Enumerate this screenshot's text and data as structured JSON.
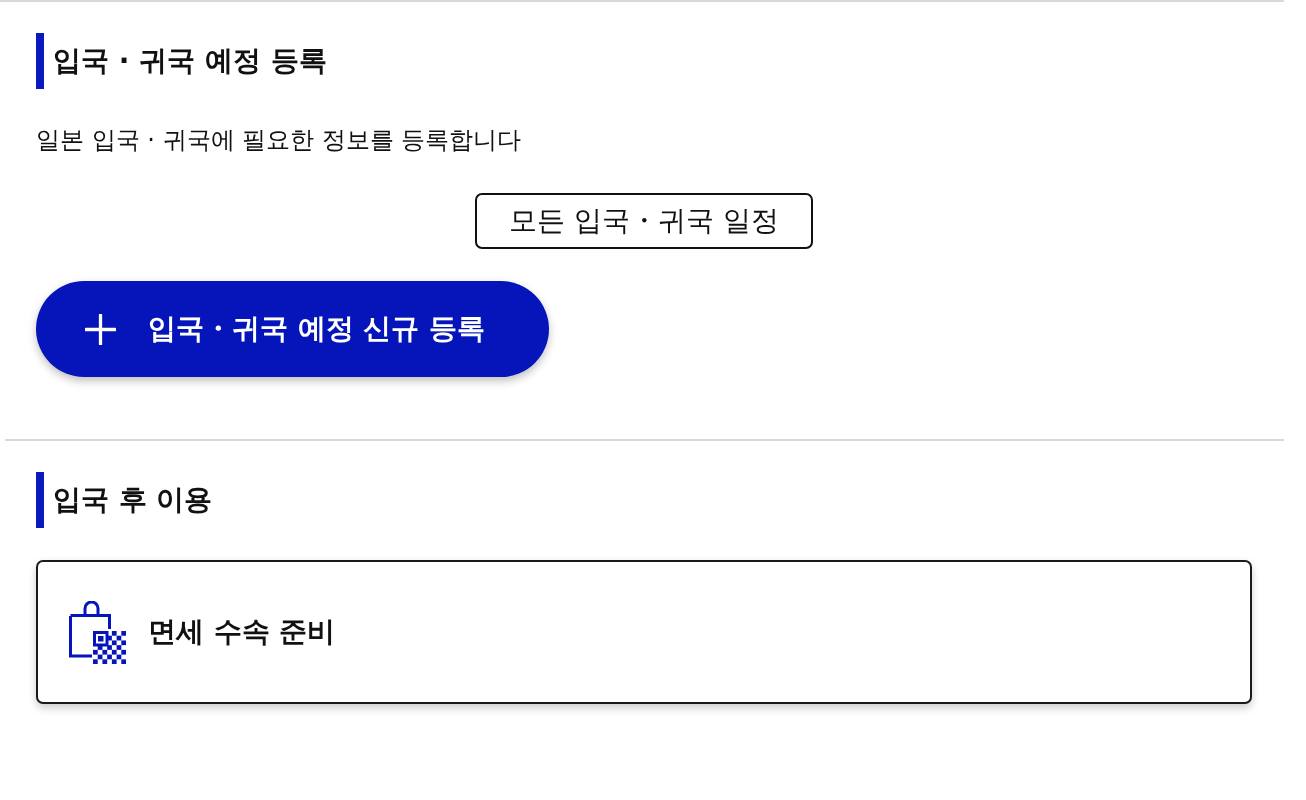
{
  "registration_section": {
    "title": "입국 · 귀국 예정 등록",
    "description": "일본 입국 · 귀국에 필요한 정보를 등록합니다",
    "schedule_button": "모든 입국・귀국 일정",
    "new_button": "입국・귀국 예정 신규 등록"
  },
  "after_entry_section": {
    "title": "입국 후 이용",
    "cards": [
      {
        "label": "면세 수속 준비"
      }
    ]
  }
}
